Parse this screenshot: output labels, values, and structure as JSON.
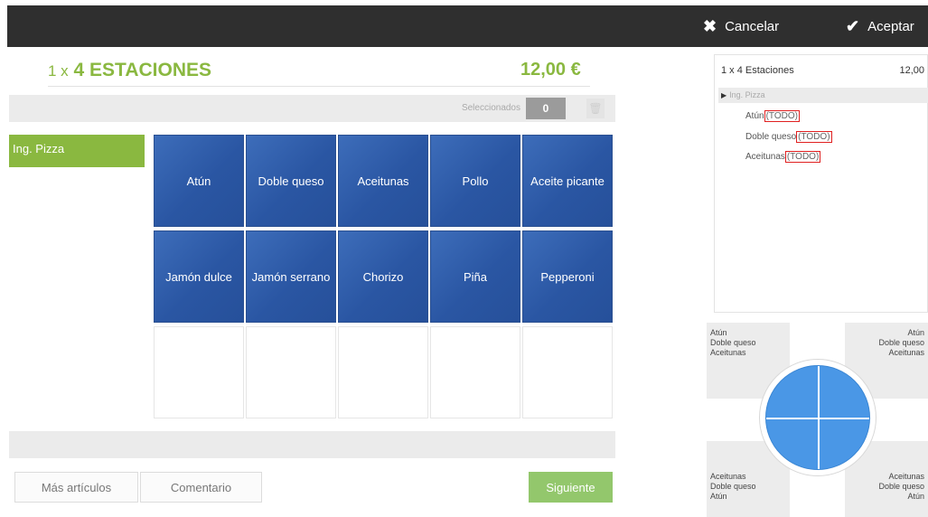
{
  "topbar": {
    "cancel_label": "Cancelar",
    "cancel_icon": "✖",
    "accept_label": "Aceptar",
    "accept_icon": "✔"
  },
  "product": {
    "qty": "1 x",
    "name": "4 ESTACIONES",
    "price": "12,00 €"
  },
  "selection": {
    "label": "Seleccionados",
    "count": "0",
    "trash_icon": "trash-icon"
  },
  "categories": [
    {
      "label": "Ing. Pizza"
    }
  ],
  "ingredients": [
    {
      "label": "Atún"
    },
    {
      "label": "Doble queso"
    },
    {
      "label": "Aceitunas"
    },
    {
      "label": "Pollo"
    },
    {
      "label": "Aceite picante"
    },
    {
      "label": "Jamón dulce"
    },
    {
      "label": "Jamón serrano"
    },
    {
      "label": "Chorizo"
    },
    {
      "label": "Piña"
    },
    {
      "label": "Pepperoni"
    }
  ],
  "buttons": {
    "more": "Más artículos",
    "comment": "Comentario",
    "next": "Siguiente"
  },
  "summary": {
    "line": "1 x 4 Estaciones",
    "price": "12,00",
    "group": "Ing. Pizza",
    "items": [
      {
        "name": "Atún",
        "tag": "(TODO)"
      },
      {
        "name": "Doble queso",
        "tag": "(TODO)"
      },
      {
        "name": "Aceitunas",
        "tag": "(TODO)"
      }
    ]
  },
  "pizza_quadrants": {
    "top_left": [
      "Atún",
      "Doble queso",
      "Aceitunas"
    ],
    "top_right": [
      "Atún",
      "Doble queso",
      "Aceitunas"
    ],
    "bottom_left": [
      "Aceitunas",
      "Doble queso",
      "Atún"
    ],
    "bottom_right": [
      "Aceitunas",
      "Doble queso",
      "Atún"
    ]
  },
  "colors": {
    "accent_green": "#8ab840",
    "tile_blue": "#2a56a3",
    "topbar": "#2f2f2f",
    "todo_red": "#e02020",
    "pizza_blue": "#4a97e6"
  }
}
